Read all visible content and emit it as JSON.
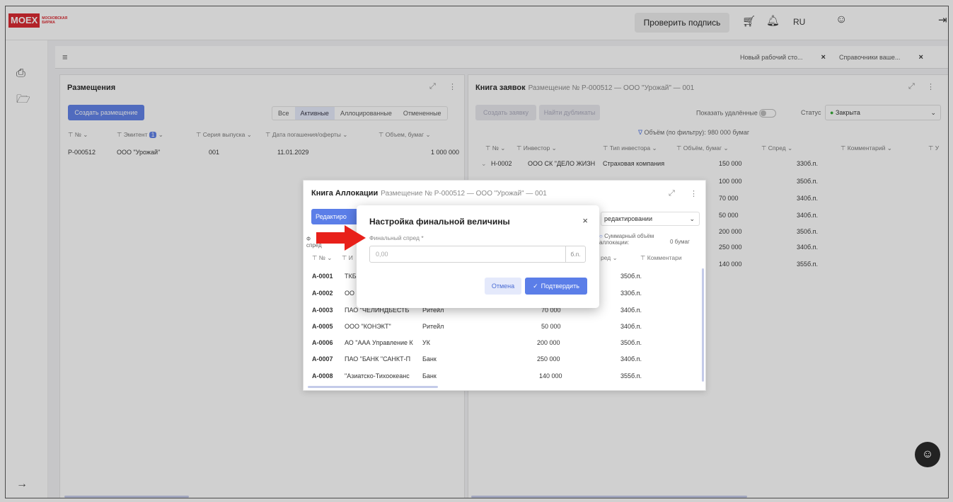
{
  "topbar": {
    "logo": "MOEX",
    "logo_sub1": "МОСКОВСКАЯ",
    "logo_sub2": "БИРЖА",
    "verify": "Проверить подпись",
    "lang": "RU"
  },
  "tabs": [
    "Новый рабочий сто...",
    "Справочники ваше..."
  ],
  "placements": {
    "title": "Размещения",
    "create": "Создать размещение",
    "filters": [
      "Все",
      "Активные",
      "Аллоцированные",
      "Отмененные"
    ],
    "headers": [
      "№",
      "Эмитент",
      "Серия выпуска",
      "Дата погашения/оферты",
      "Объем, бумаг"
    ],
    "emitent_count": "1",
    "row": [
      "P-000512",
      "ООО \"Урожай\"",
      "001",
      "11.01.2029",
      "1 000 000"
    ]
  },
  "orders": {
    "title": "Книга заявок",
    "subtitle": "Размещение № P-000512 — ООО \"Урожай\" — 001",
    "create": "Создать заявку",
    "dupes": "Найти дубликаты",
    "show_deleted": "Показать удалённые",
    "status_label": "Статус",
    "status_value": "Закрыта",
    "volume": "Объём (по фильтру): 980 000 бумаг",
    "headers": [
      "№",
      "Инвестор",
      "Тип инвестора",
      "Объём, бумаг",
      "Спред",
      "Комментарий",
      "У"
    ],
    "rows": [
      [
        "Н-0002",
        "ООО СК \"ДЕЛО ЖИЗН",
        "Страховая компания",
        "150 000",
        "330б.п."
      ],
      [
        "",
        "",
        "",
        "100 000",
        "350б.п."
      ],
      [
        "",
        "",
        "",
        "70 000",
        "340б.п."
      ],
      [
        "",
        "",
        "",
        "50 000",
        "340б.п."
      ],
      [
        "",
        "",
        "",
        "200 000",
        "350б.п."
      ],
      [
        "",
        "",
        "",
        "250 000",
        "340б.п."
      ],
      [
        "",
        "",
        "",
        "140 000",
        "355б.п."
      ]
    ]
  },
  "allocation": {
    "title": "Книга Аллокации",
    "subtitle": "Размещение № P-000512 — ООО \"Урожай\" — 001",
    "edit": "Редактиро",
    "status_select": "редактировании",
    "left_label": "Ф спред",
    "total_label": "Суммарный объём аллокации:",
    "total_value": "0 бумаг",
    "headers": [
      "№",
      "И",
      "ред",
      "Комментари"
    ],
    "rows": [
      [
        "A-0001",
        "ТКБ",
        "",
        "",
        "350б.п."
      ],
      [
        "A-0002",
        "ОО",
        "",
        "",
        "330б.п."
      ],
      [
        "A-0003",
        "ПАО \"ЧЕЛИНДБЕСТБ",
        "Ритейл",
        "70 000",
        "340б.п."
      ],
      [
        "A-0005",
        "ООО \"КОНЭКТ\"",
        "Ритейл",
        "50 000",
        "340б.п."
      ],
      [
        "A-0006",
        "АО \"ААА Управление К",
        "УК",
        "200 000",
        "350б.п."
      ],
      [
        "A-0007",
        "ПАО \"БАНК \"САНКТ-П",
        "Банк",
        "250 000",
        "340б.п."
      ],
      [
        "A-0008",
        "\"Азиатско-Тихоокеанс",
        "Банк",
        "140 000",
        "355б.п."
      ]
    ]
  },
  "modal": {
    "title": "Настройка финальной величины",
    "label": "Финальный спред *",
    "placeholder": "0,00",
    "suffix": "б.п.",
    "cancel": "Отмена",
    "confirm": "Подтвердить"
  }
}
